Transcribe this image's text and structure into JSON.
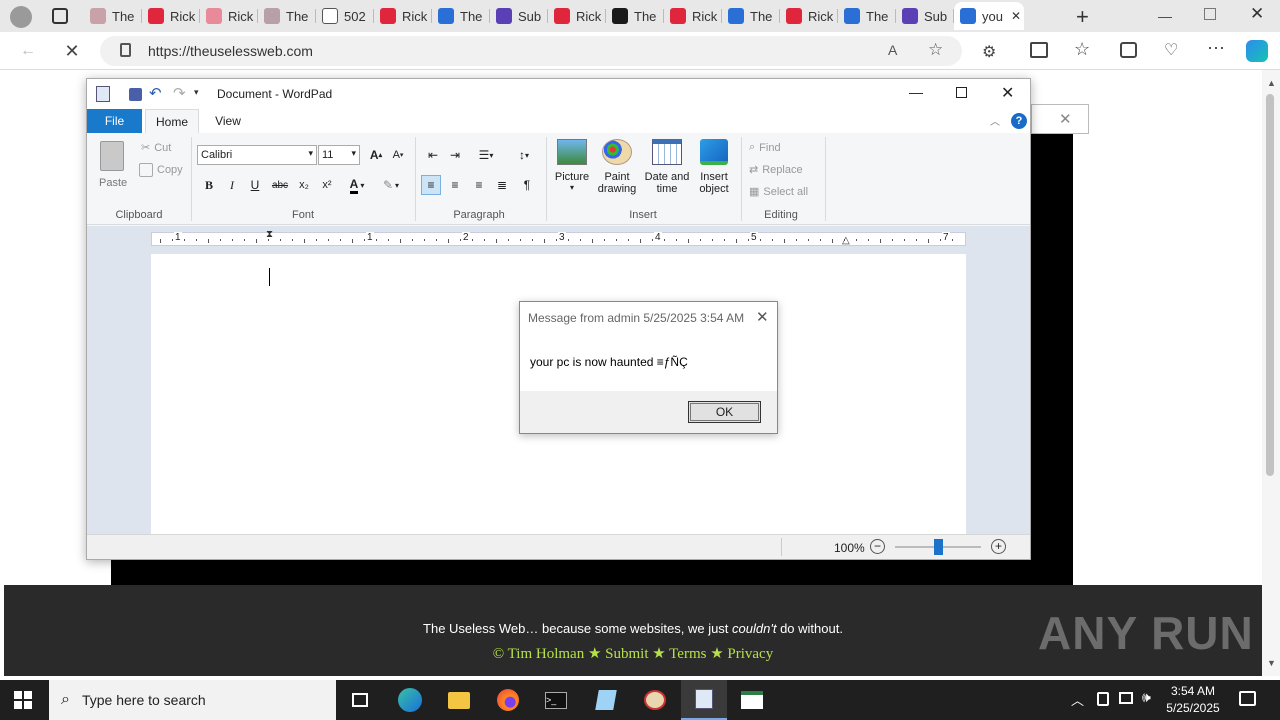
{
  "browser": {
    "tabs": [
      {
        "label": "The",
        "color": "#c8a2a8"
      },
      {
        "label": "Rick",
        "color": "#e0263c"
      },
      {
        "label": "Rick",
        "color": "#e88a9a"
      },
      {
        "label": "The",
        "color": "#b9a0a6"
      },
      {
        "label": "502",
        "color": "#ffffff"
      },
      {
        "label": "Rick",
        "color": "#e0263c"
      },
      {
        "label": "The",
        "color": "#2a6fd6"
      },
      {
        "label": "Sub",
        "color": "#5a3fb5"
      },
      {
        "label": "Rick",
        "color": "#e0263c"
      },
      {
        "label": "The",
        "color": "#1a1a1a"
      },
      {
        "label": "Rick",
        "color": "#e0263c"
      },
      {
        "label": "The",
        "color": "#2a6fd6"
      },
      {
        "label": "Rick",
        "color": "#e0263c"
      },
      {
        "label": "The",
        "color": "#2a6fd6"
      },
      {
        "label": "Sub",
        "color": "#5a3fb5"
      },
      {
        "label": "you",
        "color": "#2a6fd6"
      }
    ],
    "url": "https://theuselessweb.com"
  },
  "website": {
    "footer_line1_a": "The Useless Web… because some websites, we just ",
    "footer_line1_em": "couldn't",
    "footer_line1_b": " do without.",
    "footer_links": "© Tim Holman ★ Submit ★ Terms ★ Privacy",
    "watermark": "ANY RUN"
  },
  "wordpad": {
    "title": "Document - WordPad",
    "tabs": {
      "file": "File",
      "home": "Home",
      "view": "View"
    },
    "clipboard": {
      "paste": "Paste",
      "cut": "Cut",
      "copy": "Copy",
      "group": "Clipboard"
    },
    "font": {
      "family": "Calibri",
      "size": "11",
      "group": "Font"
    },
    "paragraph": {
      "group": "Paragraph"
    },
    "insert": {
      "picture": "Picture",
      "paint": "Paint drawing",
      "datetime": "Date and time",
      "object": "Insert object",
      "group": "Insert"
    },
    "editing": {
      "find": "Find",
      "replace": "Replace",
      "selectall": "Select all",
      "group": "Editing"
    },
    "ruler_numbers": [
      "1",
      "1",
      "2",
      "3",
      "4",
      "5",
      "7"
    ],
    "zoom": "100%"
  },
  "dialog": {
    "title": "Message from admin 5/25/2025 3:54 AM",
    "message": "your pc is now haunted ≡ƒÑÇ",
    "ok": "OK"
  },
  "taskbar": {
    "search_placeholder": "Type here to search",
    "time": "3:54 AM",
    "date": "5/25/2025"
  }
}
